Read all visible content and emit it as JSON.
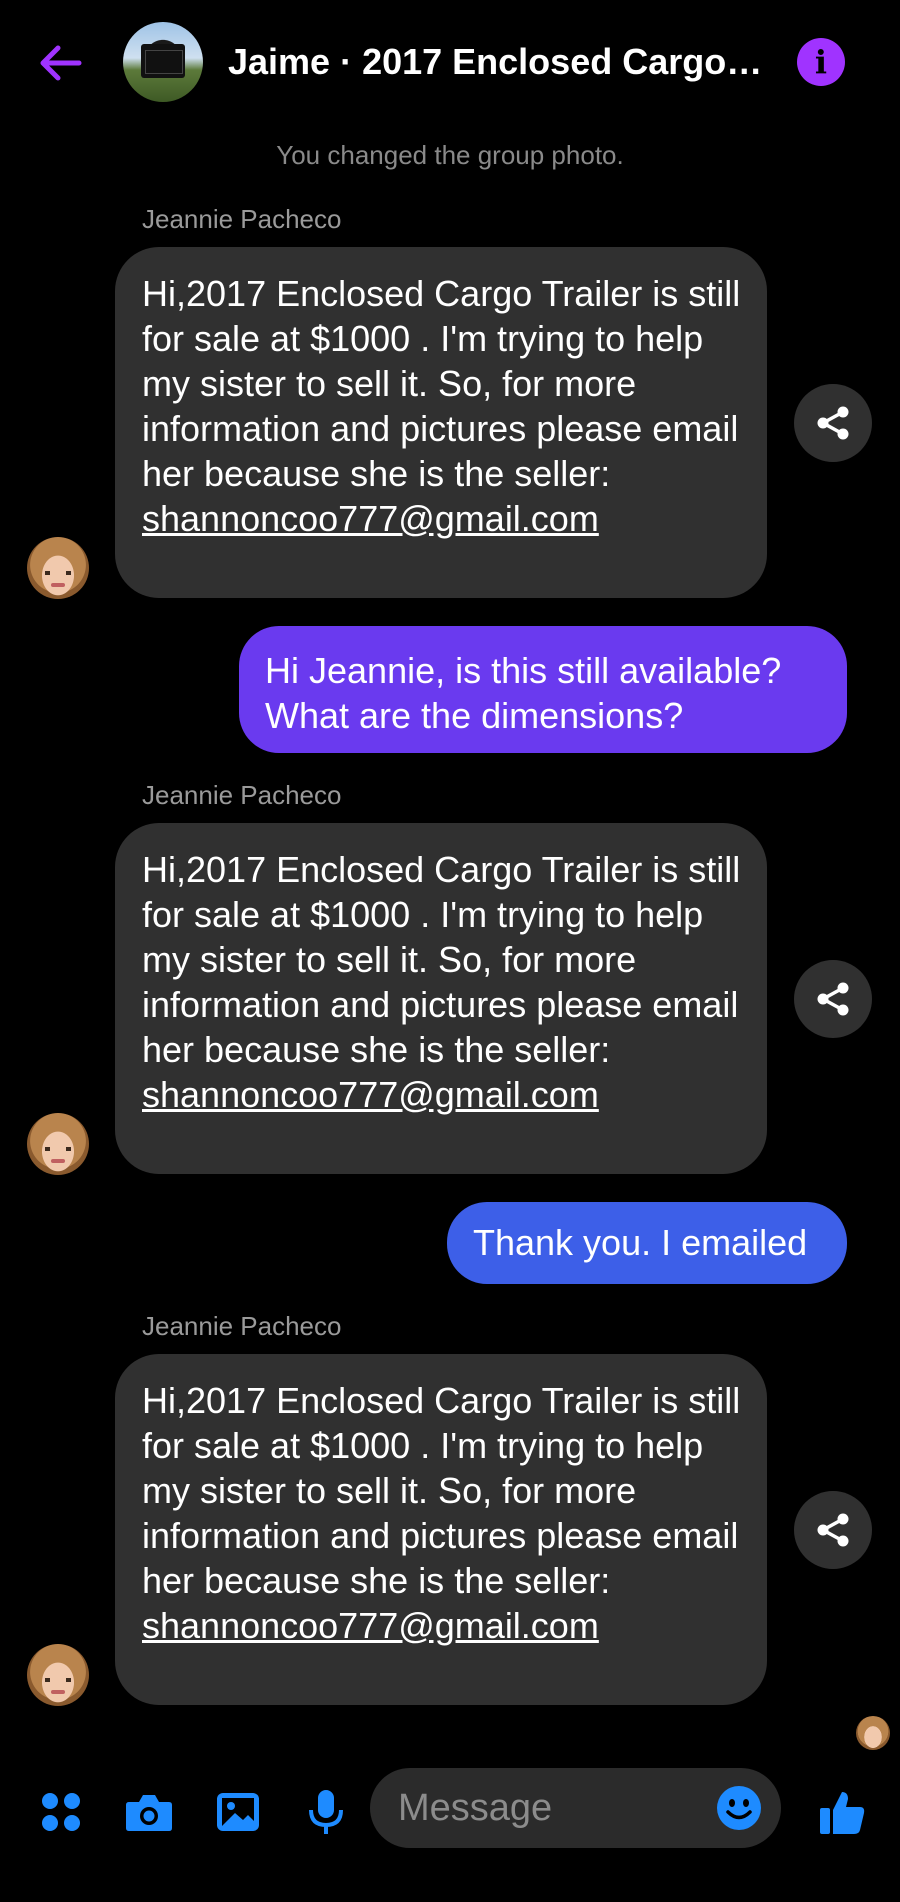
{
  "header": {
    "title": "Jaime · 2017 Enclosed  Cargo Trailer"
  },
  "system_message": "You changed the group photo.",
  "messages": [
    {
      "sender": "Jeannie Pacheco",
      "text": "Hi,2017 Enclosed Cargo Trailer is still for sale at $1000 . I'm trying to help my sister to sell it. So, for more information and pictures please email her because she is the seller:",
      "email": "shannoncoo777@gmail.com"
    },
    {
      "sender": "me",
      "text": "Hi Jeannie, is this still available? What are the dimensions?"
    },
    {
      "sender": "Jeannie Pacheco",
      "text": "Hi,2017 Enclosed Cargo Trailer is still for sale at $1000 . I'm trying to help my sister to sell it. So, for more information and pictures please email her because she is the seller:",
      "email": "shannoncoo777@gmail.com"
    },
    {
      "sender": "me",
      "text": "Thank you. I emailed"
    },
    {
      "sender": "Jeannie Pacheco",
      "text": "Hi,2017 Enclosed Cargo Trailer is still for sale at $1000 . I'm trying to help my sister to sell it. So, for more information and pictures please email her because she is the seller:",
      "email": "shannoncoo777@gmail.com"
    }
  ],
  "composer": {
    "placeholder": "Message"
  },
  "colors": {
    "accent_purple": "#a033ff",
    "outgoing_purple": "#6a3aef",
    "outgoing_blue": "#3d5fe8",
    "incoming_bubble": "#303030",
    "toolbar_blue": "#1e8bff"
  },
  "icons": [
    "back-arrow-icon",
    "info-icon",
    "share-icon",
    "apps-icon",
    "camera-icon",
    "gallery-icon",
    "microphone-icon",
    "emoji-icon",
    "thumbs-up-icon"
  ]
}
